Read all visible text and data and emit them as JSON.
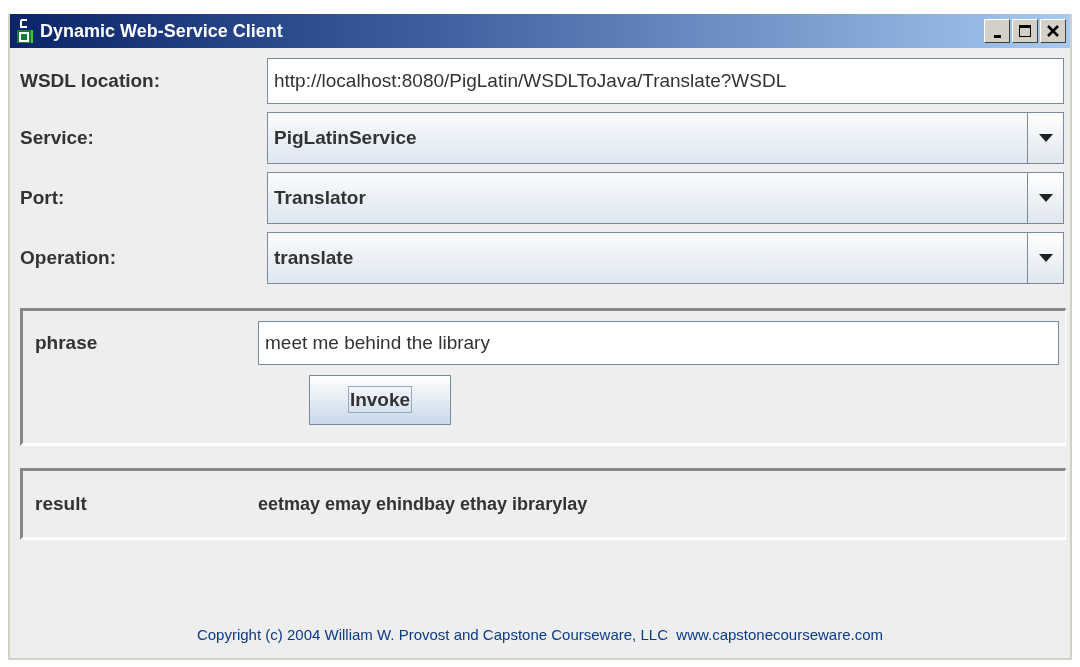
{
  "window": {
    "title": "Dynamic Web-Service Client"
  },
  "fields": [
    {
      "label": "WSDL location:",
      "kind": "text",
      "value": "http://localhost:8080/PigLatin/WSDLToJava/Translate?WSDL"
    },
    {
      "label": "Service:",
      "kind": "combo",
      "value": "PigLatinService"
    },
    {
      "label": "Port:",
      "kind": "combo",
      "value": "Translator"
    },
    {
      "label": "Operation:",
      "kind": "combo",
      "value": "translate"
    }
  ],
  "parameters": [
    {
      "name": "phrase",
      "value": "meet me behind the library"
    }
  ],
  "invoke_button": "Invoke",
  "result": {
    "label": "result",
    "value": "eetmay emay ehindbay ethay ibrarylay"
  },
  "footer": "Copyright (c) 2004 William W. Provost and Capstone Courseware, LLC  www.capstonecourseware.com"
}
